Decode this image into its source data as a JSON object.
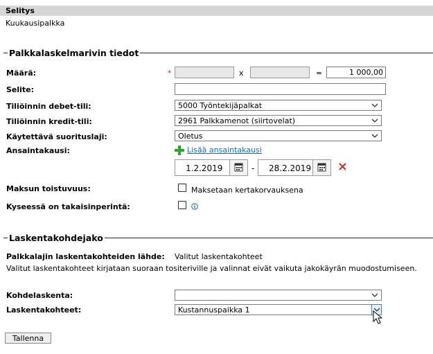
{
  "selitys": {
    "header": "Selitys",
    "value": "Kuukausipalkka"
  },
  "palkkalaskelma": {
    "title": "Palkkalaskelmarivin tiedot",
    "maara": {
      "label": "Määrä:",
      "required": "*",
      "times": "x",
      "equals": "=",
      "field1": "",
      "field2": "",
      "total": "1 000,00"
    },
    "selite": {
      "label": "Selite:",
      "value": ""
    },
    "debet": {
      "label": "Tiliöinnin debet-tili:",
      "value": "5000 Työntekijäpalkat"
    },
    "kredit": {
      "label": "Tiliöinnin kredit-tili:",
      "value": "2961 Palkkamenot (siirtovelat)"
    },
    "suorituslaji": {
      "label": "Käytettävä suorituslaji:",
      "value": "Oletus"
    },
    "ansaintakausi": {
      "label": "Ansaintakausi:",
      "add_link": "Lisää ansaintakausi",
      "start": "1.2.2019",
      "dash": "-",
      "end": "28.2.2019"
    },
    "toistuvuus": {
      "label": "Maksun toistuvuus:",
      "checkbox_label": "Maksetaan kertakorvauksena"
    },
    "takaisinperinta": {
      "label": "Kyseessä on takaisinperintä:"
    }
  },
  "laskentakohdejako": {
    "title": "Laskentakohdejako",
    "lahde_label": "Palkkalajin laskentakohteiden lähde:",
    "lahde_value": "Valitut laskentakohteet",
    "note": "Valitut laskentakohteet kirjataan suoraan tositeriville ja valinnat eivät vaikuta jakokäyrän muodostumiseen.",
    "kohdelaskenta": {
      "label": "Kohdelaskenta:",
      "value": ""
    },
    "laskentakohteet": {
      "label": "Laskentakohteet:",
      "value": "Kustannuspaikka 1"
    }
  },
  "save_button": "Tallenna",
  "colors": {
    "required": "#cc2a2a",
    "delete": "#cc2a2a",
    "add": "#2aa82a",
    "link": "#1a6aa6",
    "header_bg": "#d6d6d6"
  }
}
